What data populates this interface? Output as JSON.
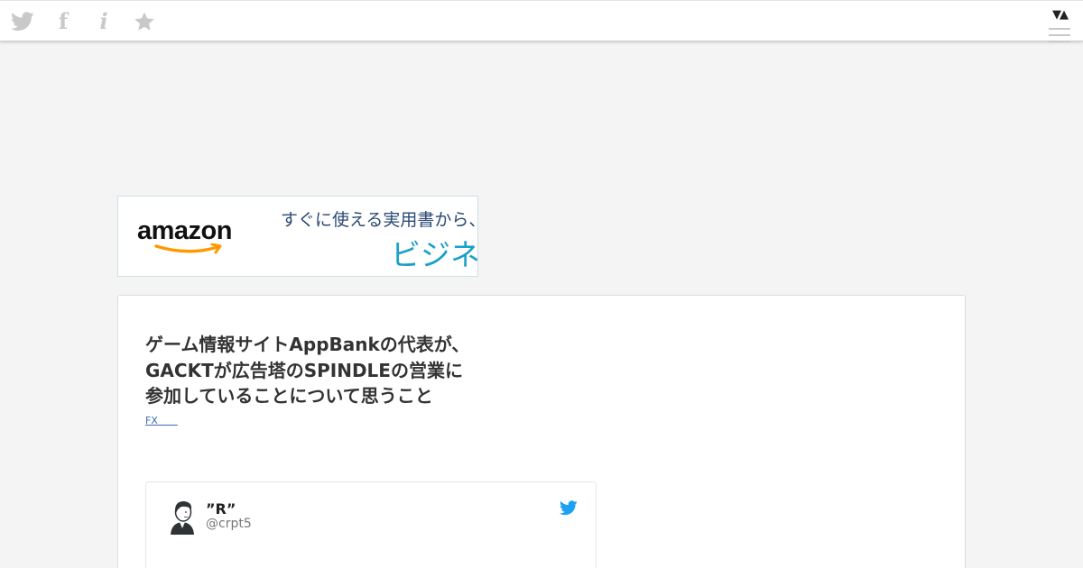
{
  "toolbar": {
    "icons": [
      "twitter-icon",
      "facebook-icon",
      "info-icon",
      "star-icon"
    ],
    "facebook_glyph": "f",
    "info_glyph": "i",
    "sort_arrows": "▼▲",
    "menu_icon": "hamburger-menu-icon",
    "icon_color": "#c9c9c9"
  },
  "ad": {
    "brand": "amazon",
    "line1": "すぐに使える実用書から、話",
    "line2": "ビジネス",
    "brand_color": "#ff9900",
    "text_color": "#2b4a73",
    "accent_color": "#1aa0c8"
  },
  "article": {
    "title_lines": [
      "ゲーム情報サイトAppBankの代表が、",
      "GACKTが広告塔のSPINDLEの営業に",
      "参加していることについて思うこと"
    ],
    "category": "FX　　"
  },
  "tweet": {
    "name": "”R”",
    "handle": "@crpt5",
    "avatar": "user-avatar",
    "bird_icon": "twitter-bird-icon",
    "bird_color": "#1da1f2"
  }
}
